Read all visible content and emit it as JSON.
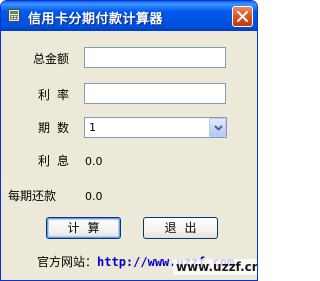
{
  "window": {
    "title": "信用卡分期付款计算器",
    "accent_color": "#0054e3",
    "close_icon": "close-icon"
  },
  "form": {
    "total_label": "总金额",
    "total_value": "",
    "rate_label": "利率",
    "rate_value": "",
    "periods_label": "期数",
    "periods_selected": "1",
    "interest_label": "利息",
    "interest_value": "0.0",
    "per_period_label": "每期还款",
    "per_period_value": "0.0"
  },
  "buttons": {
    "calculate": "计算",
    "exit": "退出"
  },
  "footer": {
    "label": "官方网站：",
    "link_text": "http://www.uzzf.com"
  },
  "watermark": {
    "text": "www.uzzf.cn"
  }
}
